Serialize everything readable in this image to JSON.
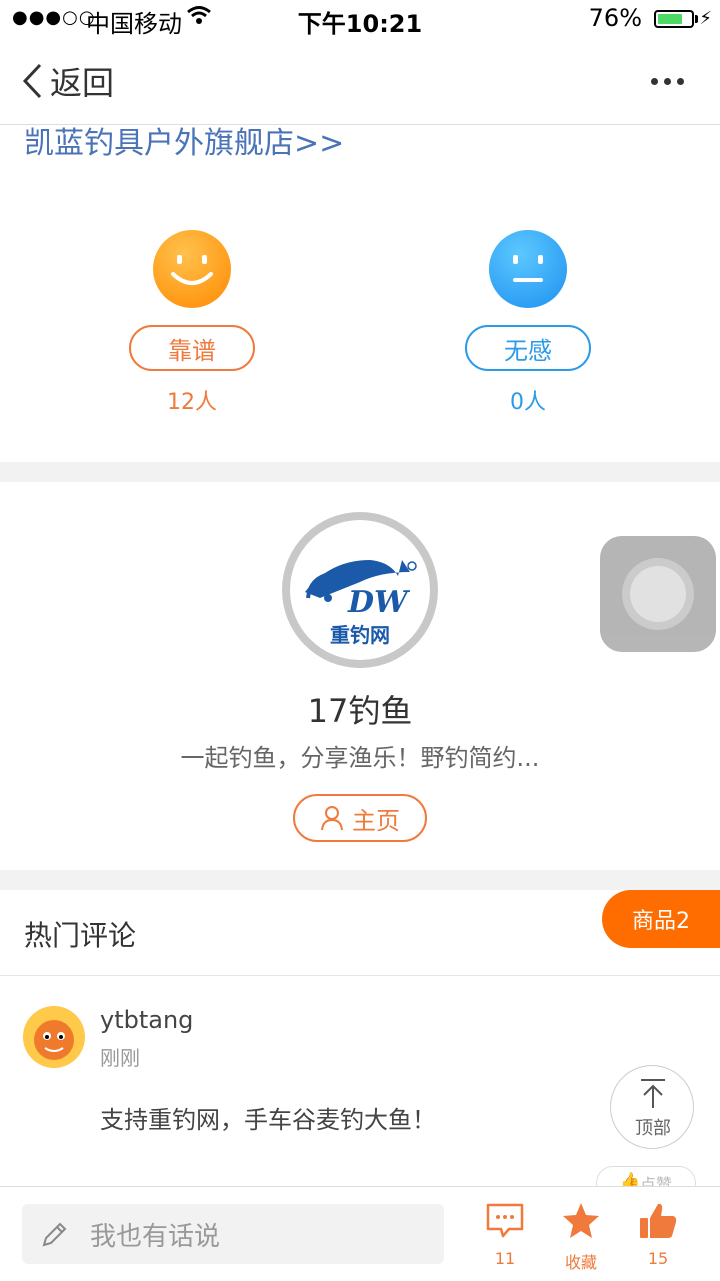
{
  "status_bar": {
    "signal": "●●●○○",
    "carrier": "中国移动",
    "time": "下午10:21",
    "battery_percent": "76%",
    "battery_level": 0.76
  },
  "nav": {
    "back_label": "返回"
  },
  "store_link": "凯蓝钓具户外旗舰店>>",
  "reactions": {
    "reliable": {
      "label": "靠谱",
      "count": "12人"
    },
    "meh": {
      "label": "无感",
      "count": "0人"
    }
  },
  "author": {
    "name": "17钓鱼",
    "description": "一起钓鱼，分享渔乐！野钓简约...",
    "homepage_label": "主页"
  },
  "comments": {
    "title": "热门评论",
    "products_tab": "商品2",
    "scroll_top_label": "顶部",
    "like_label": "点赞",
    "items": [
      {
        "user": "ytbtang",
        "time": "刚刚",
        "text": "支持重钓网，手车谷麦钓大鱼！"
      }
    ]
  },
  "bottom_bar": {
    "input_placeholder": "我也有话说",
    "comments_count": "11",
    "favorite_label": "收藏",
    "like_count": "15"
  },
  "colors": {
    "accent_orange": "#f07a3c",
    "accent_blue": "#2b9ae8",
    "link_blue": "#4a73b8",
    "tab_orange": "#ff6d00"
  },
  "icons": [
    "chevron-left-icon",
    "more-icon",
    "smile-face-icon",
    "neutral-face-icon",
    "user-icon",
    "arrow-up-icon",
    "pencil-icon",
    "comment-icon",
    "star-icon",
    "thumbs-up-icon",
    "wifi-icon"
  ]
}
